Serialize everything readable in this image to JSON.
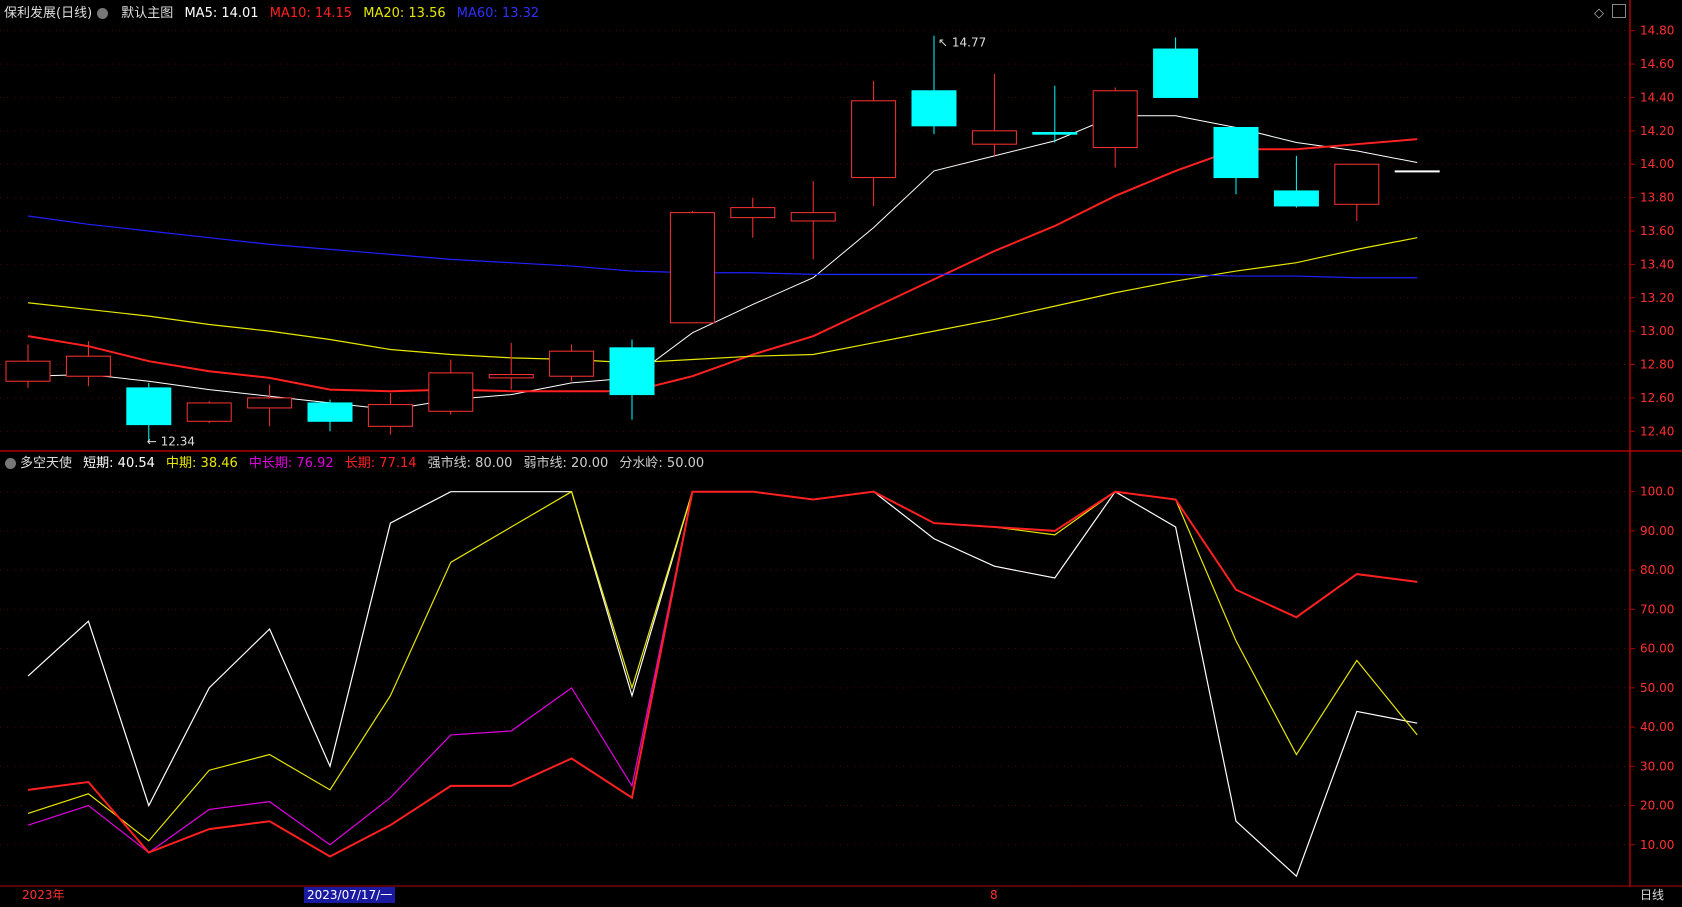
{
  "header": {
    "stock_title": "保利发展(日线)",
    "main_chart_label": "默认主图",
    "ma5": "MA5: 14.01",
    "ma10": "MA10: 14.15",
    "ma20": "MA20: 13.56",
    "ma60": "MA60: 13.32"
  },
  "indicator_header": {
    "name": "多空天使",
    "short": "短期: 40.54",
    "mid": "中期: 38.46",
    "midlong": "中长期: 76.92",
    "long": "长期: 77.14",
    "strong": "强市线: 80.00",
    "weak": "弱市线: 20.00",
    "divide": "分水岭: 50.00"
  },
  "bottom_bar": {
    "year_label": "2023年",
    "cursor_date": "2023/07/17/一",
    "month_label": "8",
    "period_button": "日线"
  },
  "colors": {
    "up": "#ff3232",
    "down": "#00ffff",
    "ma5": "#ffffff",
    "ma10": "#ff2020",
    "ma20": "#e6e600",
    "ma60": "#2020ff",
    "short": "#ffffff",
    "mid": "#e6e600",
    "midlong": "#e000e0",
    "long": "#ff2020",
    "axis": "#b00000"
  },
  "chart_data": [
    {
      "type": "candlestick",
      "title": "保利发展(日线)",
      "ylim": [
        12.3,
        14.84
      ],
      "y_ticks": [
        "14.80",
        "14.60",
        "14.40",
        "14.20",
        "14.00",
        "13.80",
        "13.60",
        "13.40",
        "13.20",
        "13.00",
        "12.80",
        "12.60",
        "12.40"
      ],
      "annotations": {
        "high": "14.77",
        "low": "12.34"
      },
      "candles": [
        {
          "open": 12.7,
          "close": 12.82,
          "high": 12.92,
          "low": 12.66
        },
        {
          "open": 12.73,
          "close": 12.85,
          "high": 12.94,
          "low": 12.67
        },
        {
          "open": 12.66,
          "close": 12.44,
          "high": 12.69,
          "low": 12.34
        },
        {
          "open": 12.46,
          "close": 12.57,
          "high": 12.58,
          "low": 12.45
        },
        {
          "open": 12.54,
          "close": 12.6,
          "high": 12.68,
          "low": 12.43
        },
        {
          "open": 12.57,
          "close": 12.46,
          "high": 12.59,
          "low": 12.4
        },
        {
          "open": 12.43,
          "close": 12.56,
          "high": 12.63,
          "low": 12.38
        },
        {
          "open": 12.52,
          "close": 12.75,
          "high": 12.83,
          "low": 12.5
        },
        {
          "open": 12.72,
          "close": 12.74,
          "high": 12.93,
          "low": 12.65
        },
        {
          "open": 12.73,
          "close": 12.88,
          "high": 12.92,
          "low": 12.7
        },
        {
          "open": 12.9,
          "close": 12.62,
          "high": 12.95,
          "low": 12.47
        },
        {
          "open": 13.05,
          "close": 13.71,
          "high": 13.72,
          "low": 13.05
        },
        {
          "open": 13.68,
          "close": 13.74,
          "high": 13.8,
          "low": 13.56
        },
        {
          "open": 13.66,
          "close": 13.71,
          "high": 13.9,
          "low": 13.43
        },
        {
          "open": 13.92,
          "close": 14.38,
          "high": 14.5,
          "low": 13.75
        },
        {
          "open": 14.44,
          "close": 14.23,
          "high": 14.77,
          "low": 14.18
        },
        {
          "open": 14.12,
          "close": 14.2,
          "high": 14.54,
          "low": 14.05
        },
        {
          "open": 14.19,
          "close": 14.18,
          "high": 14.47,
          "low": 14.13
        },
        {
          "open": 14.1,
          "close": 14.44,
          "high": 14.46,
          "low": 13.98
        },
        {
          "open": 14.69,
          "close": 14.4,
          "high": 14.76,
          "low": 14.4
        },
        {
          "open": 14.22,
          "close": 13.92,
          "high": 14.22,
          "low": 13.82
        },
        {
          "open": 13.84,
          "close": 13.75,
          "high": 14.05,
          "low": 13.74
        },
        {
          "open": 13.76,
          "close": 14.0,
          "high": 14.0,
          "low": 13.66
        },
        {
          "open": 13.96,
          "close": 13.96,
          "high": 13.96,
          "low": 13.96
        }
      ],
      "series": [
        {
          "name": "MA5",
          "values": [
            12.73,
            12.74,
            12.7,
            12.65,
            12.61,
            12.57,
            12.53,
            12.59,
            12.62,
            12.69,
            12.72,
            12.99,
            13.16,
            13.32,
            13.62,
            13.96,
            14.05,
            14.14,
            14.29,
            14.29,
            14.22,
            14.13,
            14.08,
            14.01
          ]
        },
        {
          "name": "MA10",
          "values": [
            12.97,
            12.91,
            12.82,
            12.76,
            12.72,
            12.65,
            12.64,
            12.65,
            12.64,
            12.64,
            12.64,
            12.73,
            12.86,
            12.97,
            13.14,
            13.31,
            13.48,
            13.63,
            13.81,
            13.96,
            14.09,
            14.09,
            14.12,
            14.15
          ]
        },
        {
          "name": "MA20",
          "values": [
            13.17,
            13.13,
            13.09,
            13.04,
            13.0,
            12.95,
            12.89,
            12.86,
            12.84,
            12.83,
            12.81,
            12.83,
            12.85,
            12.86,
            12.93,
            13.0,
            13.07,
            13.15,
            13.23,
            13.3,
            13.36,
            13.41,
            13.49,
            13.56
          ]
        },
        {
          "name": "MA60",
          "values": [
            13.69,
            13.64,
            13.6,
            13.56,
            13.52,
            13.49,
            13.46,
            13.43,
            13.41,
            13.39,
            13.36,
            13.35,
            13.35,
            13.34,
            13.34,
            13.34,
            13.34,
            13.34,
            13.34,
            13.34,
            13.33,
            13.33,
            13.32,
            13.32
          ]
        }
      ]
    },
    {
      "type": "line",
      "title": "多空天使",
      "ylim": [
        0,
        104
      ],
      "y_ticks": [
        "100.0",
        "90.00",
        "80.00",
        "70.00",
        "60.00",
        "50.00",
        "40.00",
        "30.00",
        "20.00",
        "10.00"
      ],
      "series": [
        {
          "name": "短期",
          "values": [
            53,
            67,
            20,
            50,
            65,
            30,
            92,
            100,
            100,
            100,
            48,
            100,
            100,
            98,
            100,
            88,
            81,
            78,
            100,
            91,
            16,
            2,
            44,
            41
          ]
        },
        {
          "name": "中期",
          "values": [
            18,
            23,
            11,
            29,
            33,
            24,
            48,
            82,
            91,
            100,
            50,
            100,
            100,
            98,
            100,
            92,
            91,
            89,
            100,
            98,
            62,
            33,
            57,
            38
          ]
        },
        {
          "name": "中长期",
          "values": [
            15,
            20,
            8,
            19,
            21,
            10,
            22,
            38,
            39,
            50,
            25,
            100,
            100,
            98,
            100,
            92,
            91,
            90,
            100,
            98,
            75,
            68,
            79,
            77
          ]
        },
        {
          "name": "长期",
          "values": [
            24,
            26,
            8,
            14,
            16,
            7,
            15,
            25,
            25,
            32,
            22,
            100,
            100,
            98,
            100,
            92,
            91,
            90,
            100,
            98,
            75,
            68,
            79,
            77
          ]
        }
      ]
    }
  ]
}
